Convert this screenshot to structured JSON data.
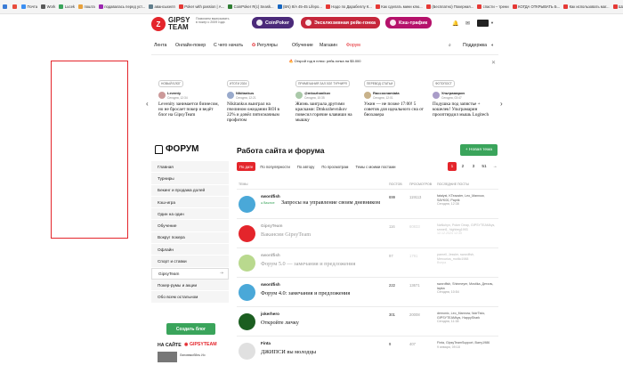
{
  "bookmarks": [
    {
      "label": "",
      "color": "#3a7bd5"
    },
    {
      "label": "",
      "color": "#e84b3c"
    },
    {
      "label": "Почта",
      "color": "#3b8ff3"
    },
    {
      "label": "Work",
      "color": "#5a5a5a"
    },
    {
      "label": "Lucek",
      "color": "#3aa45b"
    },
    {
      "label": "пошта",
      "color": "#e8a13c"
    },
    {
      "label": "подавалась перед уст...",
      "color": "#9c27b0"
    },
    {
      "label": "авансыхелп",
      "color": "#607d8b"
    },
    {
      "label": "Poker with passion | А...",
      "color": "#e53935"
    },
    {
      "label": "CoinPoker R(с) Seask...",
      "color": "#2e7d32"
    },
    {
      "label": "(BN) 8/A 45-45 Lifepo...",
      "color": "#1565c0"
    },
    {
      "label": "Надо по Дарабеллу К...",
      "color": "#e53935"
    },
    {
      "label": "Как сделать мини клю...",
      "color": "#e53935"
    },
    {
      "label": "(Бесплатно) Покерная...",
      "color": "#e53935"
    },
    {
      "label": "спасти – трени",
      "color": "#e53935"
    },
    {
      "label": "КОГДА ОТКРЫВАТЬ Б...",
      "color": "#e53935"
    },
    {
      "label": "Как использовать маг...",
      "color": "#e53935"
    },
    {
      "label": "Шаг или Конфейсен К...",
      "color": "#e53935"
    },
    {
      "label": "ЗАЩИТА БОЛЬШОГО...",
      "color": "#e53935"
    },
    {
      "label": "Это мало? Больше...",
      "color": "#e53935"
    },
    {
      "label": "ТАКОЕ Б...",
      "color": "#e53935"
    }
  ],
  "header": {
    "logo_mark": "Z",
    "logo_line1": "GIPSY",
    "logo_line2": "TEAM",
    "tagline": "Помогаем выигрывать в покер с 2009 года",
    "btn1": "CoinPoker",
    "btn2": "Эксклюзивная рейк-гонка",
    "btn3": "Кэш-трафик",
    "search_label": "Поддержка"
  },
  "nav": [
    "Лента",
    "Онлайн-покер",
    "С чего начать",
    "Регуляры",
    "Обучение",
    "Магазин",
    "Форум"
  ],
  "promo": "Открой год в плюс: рейк-гонка на $5.000",
  "cards": [
    {
      "badge": "НОВЫЙ БЛОГ",
      "author": "Leventy",
      "time": "Сегодня, 12:34",
      "title": "Levenity занимается бизнесом, но не бросает покер и ведёт блог на GipsyTeam"
    },
    {
      "badge": "ИТОГИ 2024",
      "author": "Nikitankus",
      "time": "Сегодня, 12:21",
      "title": "Nikitankus выиграл на пчелином ожидании ROI в 22% и довёл пятисмачным профитом"
    },
    {
      "badge": "ПРИМЕЧАНИЯ ЗАЛ ЗОЛ ТУРНИРЯ",
      "author": "@mkozhanikov",
      "time": "Сегодня, 10:35",
      "title": "Жизнь заиграла другими красками: Dmkozhevnikov повесил горячие клавиши на мышку"
    },
    {
      "badge": "ПЕРЕВОД СТАТЬИ",
      "author": "Raccoonamiata",
      "time": "Сегодня, 12:01",
      "title": "Ужин — не позже 17:00! 5 советов для идеального сна от биохакера"
    },
    {
      "badge": "ФОТОПОСТ",
      "author": "Ультрамарин",
      "time": "Сегодня, 03:47",
      "title": "Подушка под запястье + кошелек! Ультрамарин прооптирдил мышь Logitech"
    }
  ],
  "forum_title": "ФОРУМ",
  "sidebar": [
    {
      "label": "Главная"
    },
    {
      "label": "Турниры"
    },
    {
      "label": "Бекинг и продажа долей"
    },
    {
      "label": "Кэш-игра"
    },
    {
      "label": "Один на один"
    },
    {
      "label": "Обучение"
    },
    {
      "label": "Вокруг покера"
    },
    {
      "label": "Офлайн"
    },
    {
      "label": "Спорт и ставки"
    },
    {
      "label": "GipsyTeam"
    },
    {
      "label": "Покер-румы и акции"
    },
    {
      "label": "Обо всем остальном"
    }
  ],
  "sidebar_create": "Создать блог",
  "sidebar_footer": "НА САЙТЕ",
  "sidebar_footer_brand": "GIPSYTEAM",
  "sidebar_thumb_text": "Лаповвкобйль Ио",
  "main_title": "Работа сайта и форума",
  "new_topic": "+ Новая тема",
  "filters": [
    "По дате",
    "По популярности",
    "По автору",
    "По просмотрам",
    "Темы с моими постами"
  ],
  "pager": [
    "1",
    "2",
    "3",
    "51",
    "→"
  ],
  "thead": {
    "topic": "ТЕМЫ",
    "posts": "ПОСТОВ",
    "views": "ПРОСМОТРОВ",
    "last": "ПОСЛЕДНИЕ ПОСТЫ"
  },
  "rows": [
    {
      "author": "swordfish",
      "tag": "Важное",
      "title": "Запросы на управление своим дневником",
      "posts": "699",
      "views": "119113",
      "last": "fatalyst, KTeacster, Leo_Mannow, SAYK00, Paprik",
      "when": "Сегодня, 12:38",
      "faded": false,
      "color": "#4aa8d8"
    },
    {
      "author": "GipsyTeam",
      "tag": "",
      "title": "Вакансии GipsyTeam",
      "posts": "116",
      "views": "60833",
      "last": "NaNuhyn, Poker Deap, GIPSYTEAMkys, smnet1, highbeg1993",
      "when": "12.12.2024 12:35",
      "faded": true,
      "color": "#e4252b"
    },
    {
      "author": "swordfish",
      "tag": "",
      "title": "Форум 5.0 — замечания и предложения",
      "posts": "97",
      "views": "1791",
      "last": "parnell, Jessler, swordfish, Mercurius_motilo1988",
      "when": "Вчера",
      "faded": true,
      "color": "#b9d98e"
    },
    {
      "author": "swordfish",
      "tag": "",
      "title": "Форум 4.0: замечания и предложения",
      "posts": "222",
      "views": "13671",
      "last": "swordfish, Shinmeyer, Mostika, Деталь, lapka",
      "when": "Сегодня, 10:54",
      "faded": false,
      "color": "#4aa8d8"
    },
    {
      "author": "jokerhero",
      "tag": "",
      "title": "Откройте личку",
      "posts": "301",
      "views": "20008",
      "last": "demonic, Leo_Mannow, NoirTisto, GIPSYTEAMkys, HappyShark",
      "when": "Сегодня, 11:38",
      "faded": false,
      "color": "#1b5e20"
    },
    {
      "author": "Finta",
      "tag": "",
      "title": "ДЖИПСИ вы молодцы",
      "posts": "9",
      "views": "407",
      "last": "Finta, GipsyTeamSupport, Barry1986",
      "when": "9 января, 09:18",
      "faded": false,
      "color": "#e0e0e0"
    }
  ]
}
